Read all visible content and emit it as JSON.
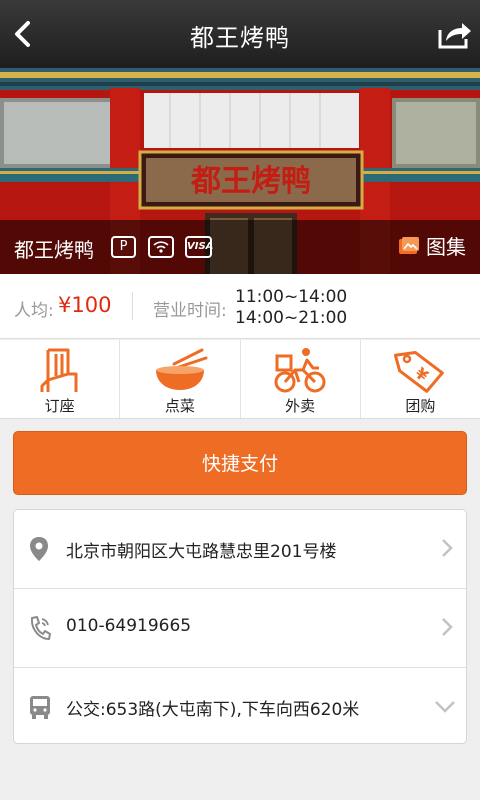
{
  "header": {
    "title": "都王烤鸭",
    "back_icon": "back-arrow-icon",
    "share_icon": "share-icon"
  },
  "hero": {
    "sign_text": "都王烤鸭",
    "restaurant_name": "都王烤鸭",
    "badges": [
      "P",
      "wifi-icon",
      "VISA"
    ],
    "gallery_label": "图集"
  },
  "info": {
    "avg_label": "人均:",
    "avg_value": "¥100",
    "hours_label": "营业时间:",
    "hours": [
      "11:00~14:00",
      "14:00~21:00"
    ]
  },
  "actions": [
    {
      "label": "订座",
      "icon": "chair-icon"
    },
    {
      "label": "点菜",
      "icon": "bowl-chopsticks-icon"
    },
    {
      "label": "外卖",
      "icon": "delivery-bike-icon"
    },
    {
      "label": "团购",
      "icon": "price-tag-icon"
    }
  ],
  "pay_button": "快捷支付",
  "details": [
    {
      "icon": "location-pin-icon",
      "text": "北京市朝阳区大屯路慧忠里201号楼",
      "chevron": "chevron-right-icon"
    },
    {
      "icon": "phone-icon",
      "text": "010-64919665",
      "chevron": "chevron-right-icon"
    },
    {
      "icon": "bus-icon",
      "text": "公交:653路(大屯南下),下车向西620米",
      "chevron": "chevron-down-icon"
    }
  ],
  "colors": {
    "accent": "#ee6c23",
    "price": "#e02a0f",
    "icon_orange": "#ee6c23",
    "topbar": "#2a2a2a"
  }
}
